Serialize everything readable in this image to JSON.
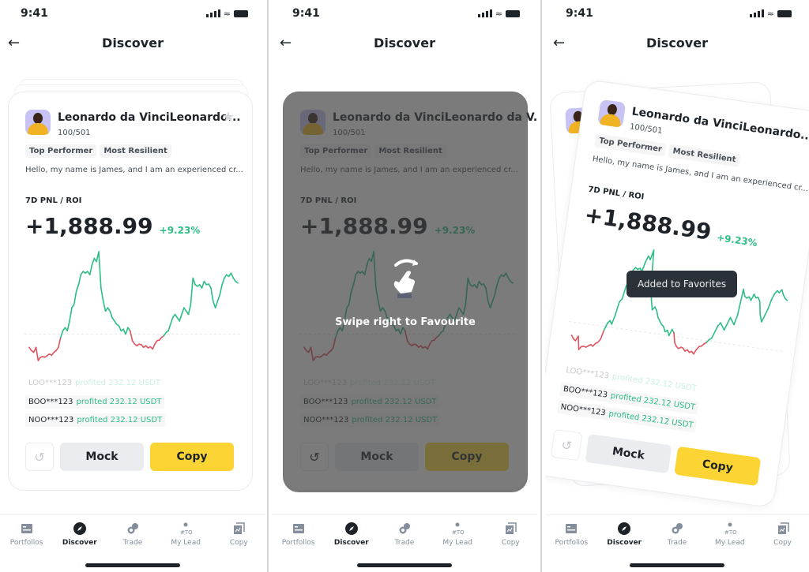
{
  "status_bar": {
    "time": "9:41"
  },
  "header": {
    "title": "Discover",
    "back_icon": "arrow-left-icon"
  },
  "card": {
    "name": "Leonardo da VinciLeonardo...",
    "name_long": "Leonardo da VinciLeonardo da V...",
    "rank": "100/501",
    "tags": [
      "Top Performer",
      "Most Resilient"
    ],
    "bio": "Hello, my name is James, and I am an experienced cr...",
    "pnl_label": "7D PNL / ROI",
    "pnl_value": "+1,888.99",
    "roi_value": "+9.23%",
    "feed": [
      {
        "user": "LOO***123",
        "msg": "profited 232.12 USDT"
      },
      {
        "user": "BOO***123",
        "msg": "profited 232.12 USDT"
      },
      {
        "user": "NOO***123",
        "msg": "profited 232.12 USDT"
      }
    ],
    "undo_icon": "undo-icon",
    "mock_label": "Mock",
    "copy_label": "Copy"
  },
  "colors": {
    "up": "#2ebd85",
    "down": "#e0535f",
    "accent": "#fcd535",
    "toast_bg": "#2b3139"
  },
  "swipe_hint": "Swipe right to Favourite",
  "toast": "Added to Favorites",
  "tabs": [
    {
      "label": "Portfolios",
      "icon": "portfolio-icon",
      "active": false
    },
    {
      "label": "Discover",
      "icon": "compass-icon",
      "active": true
    },
    {
      "label": "Trade",
      "icon": "trade-icon",
      "active": false
    },
    {
      "label": "My Lead",
      "icon": "lead-icon",
      "active": false
    },
    {
      "label": "Copy",
      "icon": "copy-icon",
      "active": false
    }
  ],
  "chart_data": {
    "type": "line",
    "title": "7D PNL",
    "baseline": 0,
    "values": [
      -4,
      -5,
      -5.5,
      -4,
      -8,
      -7,
      -6.8,
      -7,
      -6.5,
      -6,
      -6.4,
      -5.5,
      -5,
      -4,
      -1,
      1,
      2,
      1,
      4,
      8,
      9,
      13,
      15,
      18,
      19,
      18.5,
      19,
      18,
      21,
      23,
      22,
      25,
      14,
      10,
      7,
      8,
      7,
      5,
      4,
      3,
      2.5,
      1,
      1.5,
      0,
      2,
      1,
      -2,
      -3,
      -3.5,
      -3,
      -3.2,
      -4,
      -3.5,
      -4.2,
      -3.8,
      -4.5,
      -3,
      -2,
      -1.8,
      -1,
      -0.5,
      0.5,
      1,
      3,
      5,
      6,
      5,
      4,
      6,
      8,
      7,
      6,
      9,
      17,
      15,
      14.5,
      15,
      14,
      16,
      15,
      15.2,
      14,
      10,
      8,
      10,
      12,
      15,
      17,
      18,
      17.5,
      18.5,
      17,
      16,
      15.5
    ]
  }
}
